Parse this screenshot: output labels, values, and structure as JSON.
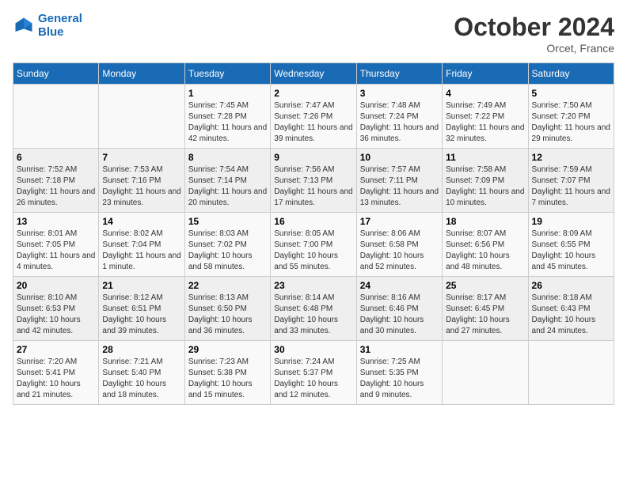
{
  "header": {
    "logo_line1": "General",
    "logo_line2": "Blue",
    "month": "October 2024",
    "location": "Orcet, France"
  },
  "weekdays": [
    "Sunday",
    "Monday",
    "Tuesday",
    "Wednesday",
    "Thursday",
    "Friday",
    "Saturday"
  ],
  "weeks": [
    [
      {
        "day": "",
        "sunrise": "",
        "sunset": "",
        "daylight": ""
      },
      {
        "day": "",
        "sunrise": "",
        "sunset": "",
        "daylight": ""
      },
      {
        "day": "1",
        "sunrise": "Sunrise: 7:45 AM",
        "sunset": "Sunset: 7:28 PM",
        "daylight": "Daylight: 11 hours and 42 minutes."
      },
      {
        "day": "2",
        "sunrise": "Sunrise: 7:47 AM",
        "sunset": "Sunset: 7:26 PM",
        "daylight": "Daylight: 11 hours and 39 minutes."
      },
      {
        "day": "3",
        "sunrise": "Sunrise: 7:48 AM",
        "sunset": "Sunset: 7:24 PM",
        "daylight": "Daylight: 11 hours and 36 minutes."
      },
      {
        "day": "4",
        "sunrise": "Sunrise: 7:49 AM",
        "sunset": "Sunset: 7:22 PM",
        "daylight": "Daylight: 11 hours and 32 minutes."
      },
      {
        "day": "5",
        "sunrise": "Sunrise: 7:50 AM",
        "sunset": "Sunset: 7:20 PM",
        "daylight": "Daylight: 11 hours and 29 minutes."
      }
    ],
    [
      {
        "day": "6",
        "sunrise": "Sunrise: 7:52 AM",
        "sunset": "Sunset: 7:18 PM",
        "daylight": "Daylight: 11 hours and 26 minutes."
      },
      {
        "day": "7",
        "sunrise": "Sunrise: 7:53 AM",
        "sunset": "Sunset: 7:16 PM",
        "daylight": "Daylight: 11 hours and 23 minutes."
      },
      {
        "day": "8",
        "sunrise": "Sunrise: 7:54 AM",
        "sunset": "Sunset: 7:14 PM",
        "daylight": "Daylight: 11 hours and 20 minutes."
      },
      {
        "day": "9",
        "sunrise": "Sunrise: 7:56 AM",
        "sunset": "Sunset: 7:13 PM",
        "daylight": "Daylight: 11 hours and 17 minutes."
      },
      {
        "day": "10",
        "sunrise": "Sunrise: 7:57 AM",
        "sunset": "Sunset: 7:11 PM",
        "daylight": "Daylight: 11 hours and 13 minutes."
      },
      {
        "day": "11",
        "sunrise": "Sunrise: 7:58 AM",
        "sunset": "Sunset: 7:09 PM",
        "daylight": "Daylight: 11 hours and 10 minutes."
      },
      {
        "day": "12",
        "sunrise": "Sunrise: 7:59 AM",
        "sunset": "Sunset: 7:07 PM",
        "daylight": "Daylight: 11 hours and 7 minutes."
      }
    ],
    [
      {
        "day": "13",
        "sunrise": "Sunrise: 8:01 AM",
        "sunset": "Sunset: 7:05 PM",
        "daylight": "Daylight: 11 hours and 4 minutes."
      },
      {
        "day": "14",
        "sunrise": "Sunrise: 8:02 AM",
        "sunset": "Sunset: 7:04 PM",
        "daylight": "Daylight: 11 hours and 1 minute."
      },
      {
        "day": "15",
        "sunrise": "Sunrise: 8:03 AM",
        "sunset": "Sunset: 7:02 PM",
        "daylight": "Daylight: 10 hours and 58 minutes."
      },
      {
        "day": "16",
        "sunrise": "Sunrise: 8:05 AM",
        "sunset": "Sunset: 7:00 PM",
        "daylight": "Daylight: 10 hours and 55 minutes."
      },
      {
        "day": "17",
        "sunrise": "Sunrise: 8:06 AM",
        "sunset": "Sunset: 6:58 PM",
        "daylight": "Daylight: 10 hours and 52 minutes."
      },
      {
        "day": "18",
        "sunrise": "Sunrise: 8:07 AM",
        "sunset": "Sunset: 6:56 PM",
        "daylight": "Daylight: 10 hours and 48 minutes."
      },
      {
        "day": "19",
        "sunrise": "Sunrise: 8:09 AM",
        "sunset": "Sunset: 6:55 PM",
        "daylight": "Daylight: 10 hours and 45 minutes."
      }
    ],
    [
      {
        "day": "20",
        "sunrise": "Sunrise: 8:10 AM",
        "sunset": "Sunset: 6:53 PM",
        "daylight": "Daylight: 10 hours and 42 minutes."
      },
      {
        "day": "21",
        "sunrise": "Sunrise: 8:12 AM",
        "sunset": "Sunset: 6:51 PM",
        "daylight": "Daylight: 10 hours and 39 minutes."
      },
      {
        "day": "22",
        "sunrise": "Sunrise: 8:13 AM",
        "sunset": "Sunset: 6:50 PM",
        "daylight": "Daylight: 10 hours and 36 minutes."
      },
      {
        "day": "23",
        "sunrise": "Sunrise: 8:14 AM",
        "sunset": "Sunset: 6:48 PM",
        "daylight": "Daylight: 10 hours and 33 minutes."
      },
      {
        "day": "24",
        "sunrise": "Sunrise: 8:16 AM",
        "sunset": "Sunset: 6:46 PM",
        "daylight": "Daylight: 10 hours and 30 minutes."
      },
      {
        "day": "25",
        "sunrise": "Sunrise: 8:17 AM",
        "sunset": "Sunset: 6:45 PM",
        "daylight": "Daylight: 10 hours and 27 minutes."
      },
      {
        "day": "26",
        "sunrise": "Sunrise: 8:18 AM",
        "sunset": "Sunset: 6:43 PM",
        "daylight": "Daylight: 10 hours and 24 minutes."
      }
    ],
    [
      {
        "day": "27",
        "sunrise": "Sunrise: 7:20 AM",
        "sunset": "Sunset: 5:41 PM",
        "daylight": "Daylight: 10 hours and 21 minutes."
      },
      {
        "day": "28",
        "sunrise": "Sunrise: 7:21 AM",
        "sunset": "Sunset: 5:40 PM",
        "daylight": "Daylight: 10 hours and 18 minutes."
      },
      {
        "day": "29",
        "sunrise": "Sunrise: 7:23 AM",
        "sunset": "Sunset: 5:38 PM",
        "daylight": "Daylight: 10 hours and 15 minutes."
      },
      {
        "day": "30",
        "sunrise": "Sunrise: 7:24 AM",
        "sunset": "Sunset: 5:37 PM",
        "daylight": "Daylight: 10 hours and 12 minutes."
      },
      {
        "day": "31",
        "sunrise": "Sunrise: 7:25 AM",
        "sunset": "Sunset: 5:35 PM",
        "daylight": "Daylight: 10 hours and 9 minutes."
      },
      {
        "day": "",
        "sunrise": "",
        "sunset": "",
        "daylight": ""
      },
      {
        "day": "",
        "sunrise": "",
        "sunset": "",
        "daylight": ""
      }
    ]
  ]
}
